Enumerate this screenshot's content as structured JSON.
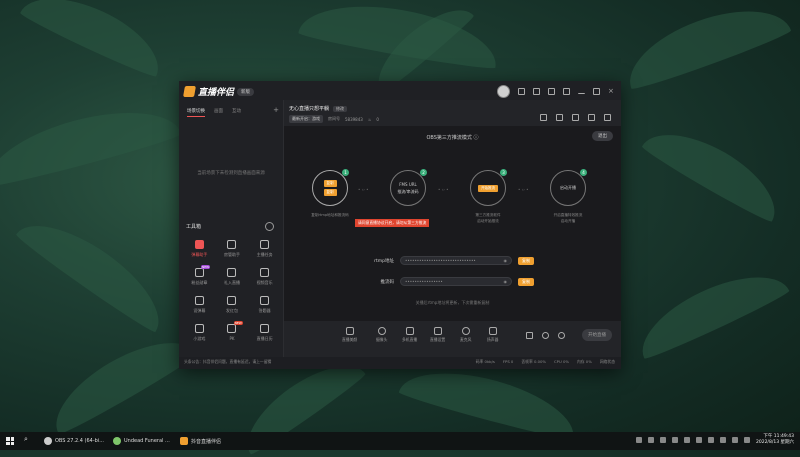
{
  "app": {
    "name": "直播伴侣",
    "version": "新版",
    "accent": "#f0a030",
    "danger": "#e0452f"
  },
  "left_panel": {
    "tabs": [
      "场景切换",
      "画面",
      "互动"
    ],
    "empty_text": "当前场景下未检测到直播画面来源",
    "tools_title": "工具箱",
    "tools": [
      {
        "label": "弹幕助手",
        "icon": "danmu-icon",
        "active": true
      },
      {
        "label": "房管助手",
        "icon": "user-icon"
      },
      {
        "label": "主播任务",
        "icon": "task-icon"
      },
      {
        "label": "粉丝勋章",
        "icon": "badge-icon",
        "tag": "NEW"
      },
      {
        "label": "礼入直播",
        "icon": "download-icon"
      },
      {
        "label": "视频音乐",
        "icon": "music-icon"
      },
      {
        "label": "设弹幕",
        "icon": "screen-icon"
      },
      {
        "label": "发红包",
        "icon": "download-icon"
      },
      {
        "label": "答题器",
        "icon": "calendar-icon"
      },
      {
        "label": "小游戏",
        "icon": "game-icon"
      },
      {
        "label": "PK",
        "icon": "pk-icon",
        "tag": "NEW"
      },
      {
        "label": "直播日历",
        "icon": "calendar-icon"
      }
    ]
  },
  "room": {
    "title": "无心直播只想平躺",
    "tag": "修改",
    "category": "最新开启：游戏",
    "viewers_label": "房间号",
    "room_id": "5839843",
    "likes": "0"
  },
  "stage": {
    "mode_title": "OBS第三方推流模式",
    "exit_label": "退出",
    "steps": [
      {
        "num": "1",
        "buttons": [
          "复制",
          "复制"
        ],
        "desc": "复制rtmp地址和推流码"
      },
      {
        "num": "2",
        "title": "FMS URL",
        "subtitle": "推流/串流码",
        "desc": ""
      },
      {
        "num": "3",
        "title": "开始推流",
        "desc": "第三方推流软件\n启动开始推流"
      },
      {
        "num": "4",
        "title": "启动开播",
        "desc": "开启直播特效推流\n启动开播"
      }
    ],
    "alert": "请同意直播协议开启，请勿从第三方推流",
    "rtmp_label": "rtmp地址",
    "rtmp_value": "••••••••••••••••••••••••••••••",
    "key_label": "推流码",
    "key_value": "••••••••••••••••",
    "copy_label": "复制",
    "tip": "关播后rtmp地址将更新，下次需重新复制"
  },
  "bottom_toolbar": {
    "items": [
      "直播美颜",
      "摄像头",
      "多机直播",
      "直播设置",
      "麦克风",
      "扬声器"
    ],
    "go_live": "开始直播"
  },
  "status_bar": {
    "notice": "头条公告：抖音伴侣问题，直播有延迟，请上一留猜",
    "stats": [
      "码率 0kb/s",
      "FPS 0",
      "丢帧率 0.00%",
      "CPU 0%",
      "内存 0%",
      "网络状态"
    ]
  },
  "taskbar": {
    "items": [
      {
        "label": "OBS 27.2.4 (64-bi...",
        "color": "#ccc"
      },
      {
        "label": "Undead Funeral ...",
        "color": "#7ec66a"
      },
      {
        "label": "抖音直播伴侣",
        "color": "#f0a030"
      }
    ],
    "time": "下午 11:49:43",
    "date": "2022/8/13 星期六"
  }
}
